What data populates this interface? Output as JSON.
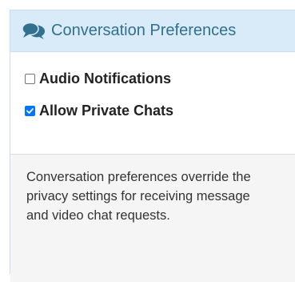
{
  "panel": {
    "title": "Conversation Preferences",
    "icon": "comments-icon",
    "accent_color": "#31708f",
    "heading_bg": "#d9ebf8"
  },
  "options": [
    {
      "label": "Audio Notifications",
      "checked": false
    },
    {
      "label": "Allow Private Chats",
      "checked": true
    }
  ],
  "footer": {
    "text": "Conversation preferences override the privacy settings for receiving message and video chat requests."
  }
}
